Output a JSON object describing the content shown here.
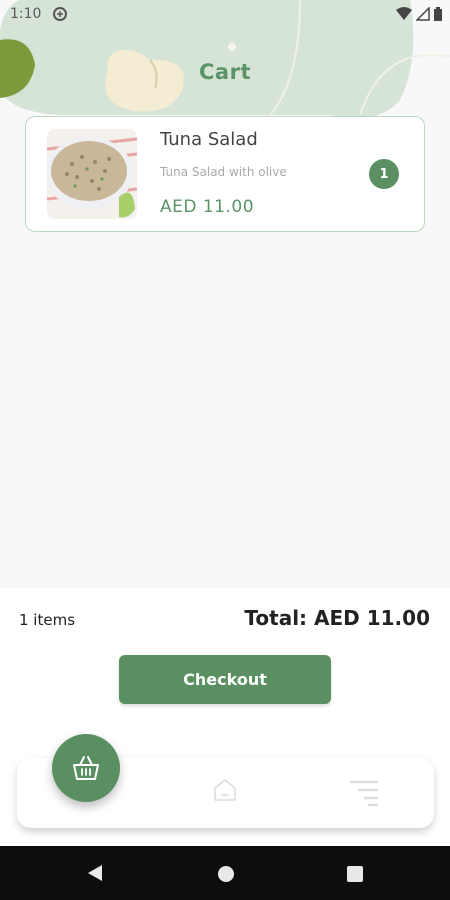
{
  "status_bar": {
    "time": "1:10",
    "icons": [
      "app-notification-icon",
      "wifi-icon",
      "signal-icon",
      "battery-icon"
    ]
  },
  "header": {
    "title": "Cart"
  },
  "cart": {
    "items": [
      {
        "name": "Tuna Salad",
        "description": "Tuna Salad with olive",
        "price": "AED 11.00",
        "quantity": "1"
      }
    ]
  },
  "summary": {
    "items_count": "1 items",
    "total": "Total: AED 11.00",
    "checkout_label": "Checkout"
  },
  "bottom_nav": {
    "items": [
      "basket-icon",
      "home-icon",
      "menu-icon"
    ]
  },
  "colors": {
    "accent": "#5a8f62",
    "title_green": "#5a9366",
    "header_bg": "#d6e4d8"
  }
}
